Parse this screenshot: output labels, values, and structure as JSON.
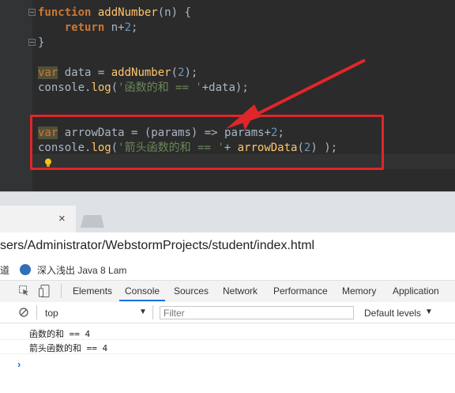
{
  "editor": {
    "lines": [
      {
        "tokens": [
          {
            "t": "function",
            "c": "kw"
          },
          {
            "t": " ",
            "c": "plain"
          },
          {
            "t": "addNumber",
            "c": "fn"
          },
          {
            "t": "(n) {",
            "c": "plain"
          }
        ]
      },
      {
        "tokens": [
          {
            "t": "    ",
            "c": "plain"
          },
          {
            "t": "return",
            "c": "kw"
          },
          {
            "t": " n+",
            "c": "plain"
          },
          {
            "t": "2",
            "c": "num"
          },
          {
            "t": ";",
            "c": "plain"
          }
        ]
      },
      {
        "tokens": [
          {
            "t": "}",
            "c": "plain"
          }
        ]
      },
      {
        "tokens": []
      },
      {
        "tokens": [
          {
            "t": "var",
            "c": "kw-var"
          },
          {
            "t": " data = ",
            "c": "plain"
          },
          {
            "t": "addNumber",
            "c": "fn"
          },
          {
            "t": "(",
            "c": "plain"
          },
          {
            "t": "2",
            "c": "num"
          },
          {
            "t": ");",
            "c": "plain"
          }
        ]
      },
      {
        "tokens": [
          {
            "t": "console.",
            "c": "plain"
          },
          {
            "t": "log",
            "c": "fn"
          },
          {
            "t": "(",
            "c": "plain"
          },
          {
            "t": "'函数的和 == '",
            "c": "str"
          },
          {
            "t": "+data);",
            "c": "plain"
          }
        ]
      },
      {
        "tokens": []
      },
      {
        "tokens": []
      },
      {
        "tokens": [
          {
            "t": "var",
            "c": "kw-var"
          },
          {
            "t": " arrowData = (params) => params+",
            "c": "plain"
          },
          {
            "t": "2",
            "c": "num"
          },
          {
            "t": ";",
            "c": "plain"
          }
        ]
      },
      {
        "tokens": [
          {
            "t": "console.",
            "c": "plain"
          },
          {
            "t": "log",
            "c": "fn"
          },
          {
            "t": "(",
            "c": "plain"
          },
          {
            "t": "'箭头函数的和 == '",
            "c": "str"
          },
          {
            "t": "+ ",
            "c": "plain"
          },
          {
            "t": "arrowData",
            "c": "fn"
          },
          {
            "t": "(",
            "c": "plain"
          },
          {
            "t": "2",
            "c": "num"
          },
          {
            "t": ") );",
            "c": "plain"
          }
        ]
      }
    ],
    "colors": {
      "background": "#2b2b2b",
      "gutter": "#313335",
      "annotation": "#e0262a"
    }
  },
  "browser": {
    "tab_close": "×",
    "address": "sers/Administrator/WebstormProjects/student/index.html",
    "bookmark_left": "道",
    "bookmark_label": "深入浅出 Java 8 Lam"
  },
  "devtools": {
    "tabs": [
      "Elements",
      "Console",
      "Sources",
      "Network",
      "Performance",
      "Memory",
      "Application"
    ],
    "active_tab": "Console",
    "context": "top",
    "filter_placeholder": "Filter",
    "levels": "Default levels",
    "logs": [
      "函数的和 == 4",
      "箭头函数的和 == 4"
    ],
    "prompt": "›"
  }
}
